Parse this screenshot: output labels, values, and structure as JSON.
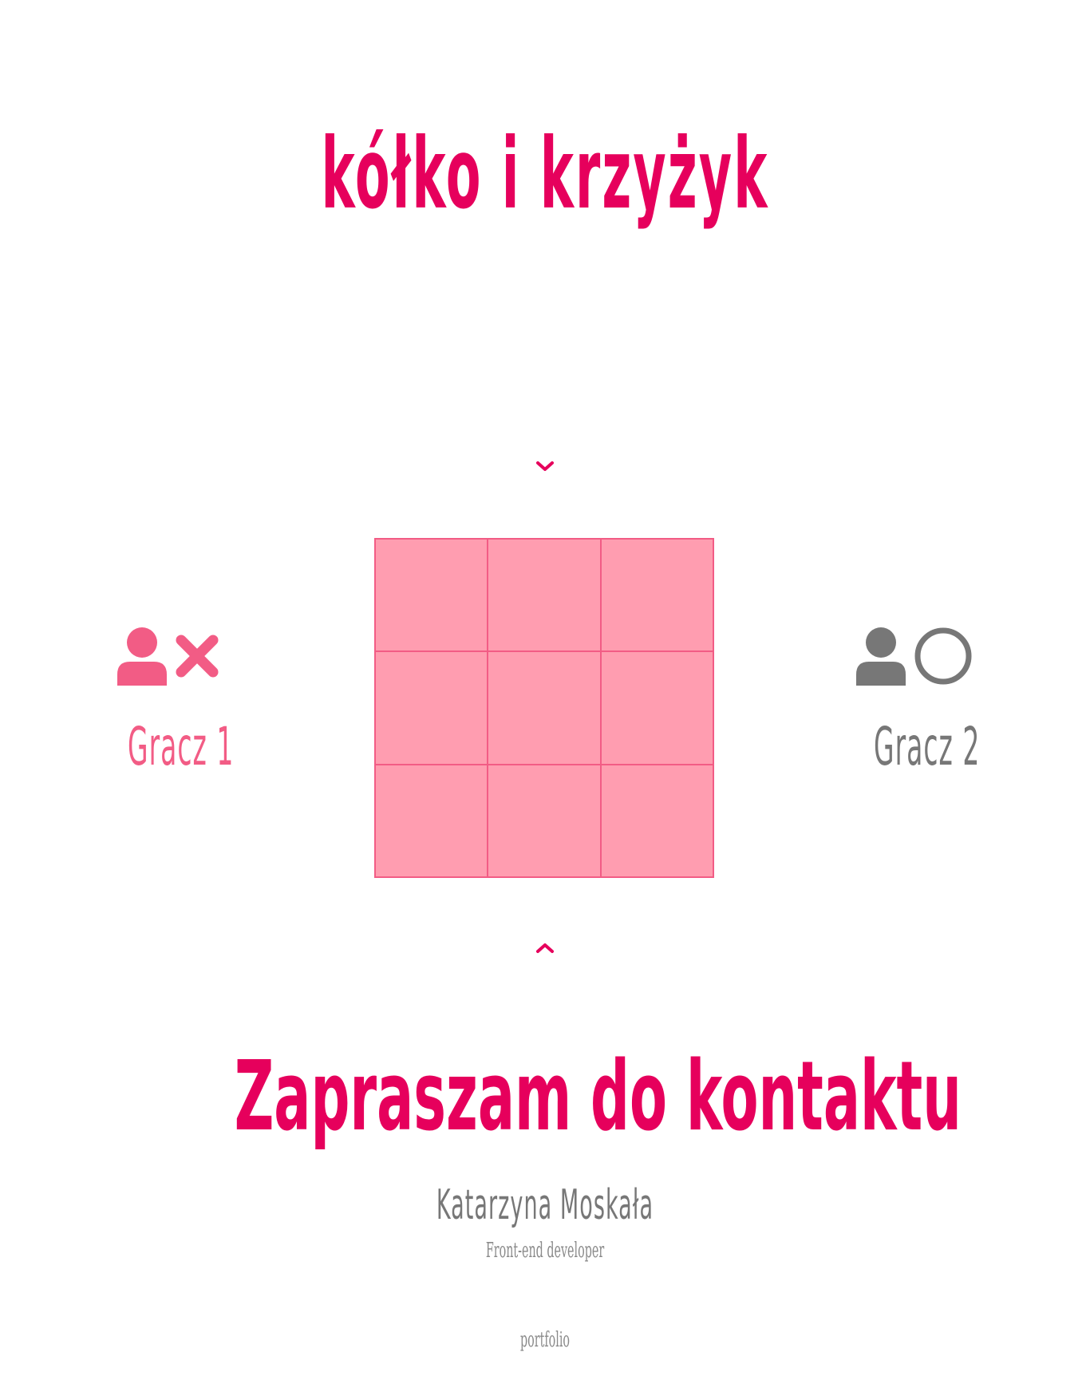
{
  "game": {
    "title": "kółko i krzyżyk",
    "board": {
      "cells": [
        "",
        "",
        "",
        "",
        "",
        "",
        "",
        "",
        ""
      ]
    },
    "player1": {
      "name": "Gracz 1",
      "icon": "user-icon",
      "symbol_icon": "cross-icon",
      "color": "#f25c85"
    },
    "player2": {
      "name": "Gracz 2",
      "icon": "user-icon",
      "symbol_icon": "circle-icon",
      "color": "#777777"
    },
    "chevron_top_icon": "chevron-down-icon",
    "chevron_bottom_icon": "chevron-up-icon"
  },
  "contact": {
    "heading": "Zapraszam do kontaktu",
    "author": "Katarzyna Moskała",
    "role": "Front-end developer",
    "portfolio_label": "portfolio"
  },
  "colors": {
    "accent": "#e6005c",
    "board_fill": "#ff9db0",
    "board_line": "#f25c85",
    "muted": "#777777"
  }
}
